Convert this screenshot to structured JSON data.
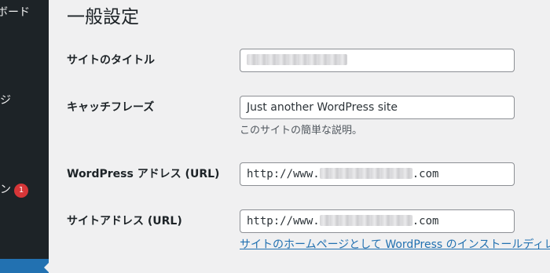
{
  "sidebar": {
    "items": [
      {
        "label": "ボード"
      },
      {
        "label": "ジ"
      },
      {
        "label": "ン",
        "badge": "1"
      }
    ]
  },
  "page": {
    "title": "一般設定"
  },
  "settings": {
    "site_title": {
      "label": "サイトのタイトル",
      "value": ""
    },
    "tagline": {
      "label": "キャッチフレーズ",
      "value": "Just another WordPress site",
      "description": "このサイトの簡単な説明。"
    },
    "wp_address": {
      "label": "WordPress アドレス (URL)",
      "value_prefix": "http://www.",
      "value_suffix": ".com"
    },
    "site_address": {
      "label": "サイトアドレス (URL)",
      "value_prefix": "http://www.",
      "value_suffix": ".com",
      "help_link": "サイトのホームページとして WordPress のインストールディレ"
    }
  },
  "colors": {
    "sidebar_bg": "#1d2327",
    "accent": "#2271b1",
    "badge": "#d63638"
  }
}
